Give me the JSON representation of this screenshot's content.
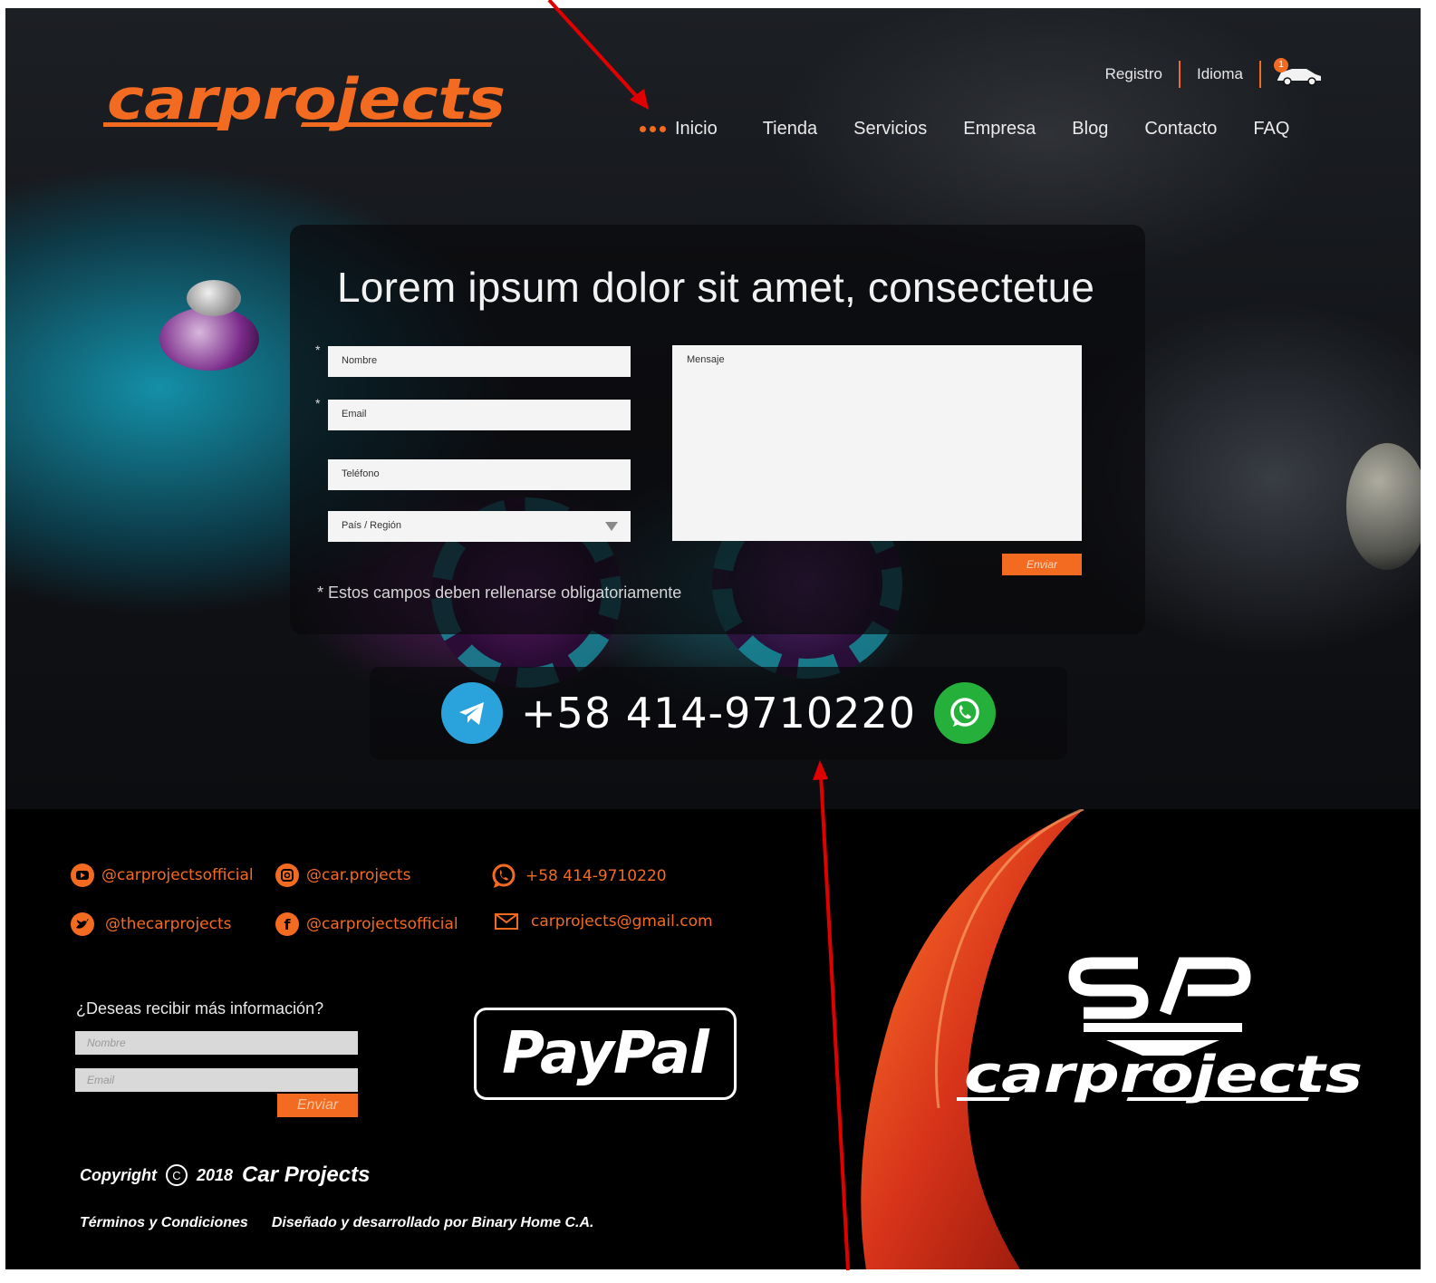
{
  "header": {
    "brand": "carprojects",
    "top_links": [
      "Registro",
      "Idioma"
    ],
    "cart_count": "1",
    "nav": [
      {
        "label": "Inicio",
        "active": true
      },
      {
        "label": "Tienda"
      },
      {
        "label": "Servicios"
      },
      {
        "label": "Empresa"
      },
      {
        "label": "Blog"
      },
      {
        "label": "Contacto"
      },
      {
        "label": "FAQ"
      }
    ]
  },
  "contact_form": {
    "title": "Lorem ipsum dolor sit amet, consectetue",
    "fields": {
      "name": "Nombre",
      "email": "Email",
      "phone": "Teléfono",
      "country": "País / Región",
      "message": "Mensaje"
    },
    "required_mark": "*",
    "submit": "Enviar",
    "note": "Estos campos deben rellenarse obligatoriamente"
  },
  "phone_bar": {
    "number": "+58 414-9710220"
  },
  "footer": {
    "social": {
      "youtube": "@carprojectsofficial",
      "instagram": "@car.projects",
      "twitter": "@thecarprojects",
      "facebook": "@carprojectsofficial",
      "whatsapp": "+58 414-9710220",
      "email": "carprojects@gmail.com"
    },
    "newsletter": {
      "title": "¿Deseas recibir más información?",
      "name_placeholder": "Nombre",
      "email_placeholder": "Email",
      "submit": "Enviar"
    },
    "paypal": "PayPal",
    "copyright": {
      "label": "Copyright",
      "symbol": "C",
      "year": "2018",
      "company": "Car Projects"
    },
    "terms": "Términos y Condiciones",
    "credits": "Diseñado y desarrollado por Binary Home C.A.",
    "brand": "carprojects"
  },
  "colors": {
    "accent": "#f26b21",
    "telegram": "#2aa3dc",
    "whatsapp": "#25b03b",
    "annotation": "#e00000"
  },
  "icons": [
    "cart-icon",
    "telegram-icon",
    "whatsapp-icon",
    "youtube-icon",
    "instagram-icon",
    "twitter-icon",
    "facebook-icon",
    "mail-icon"
  ]
}
